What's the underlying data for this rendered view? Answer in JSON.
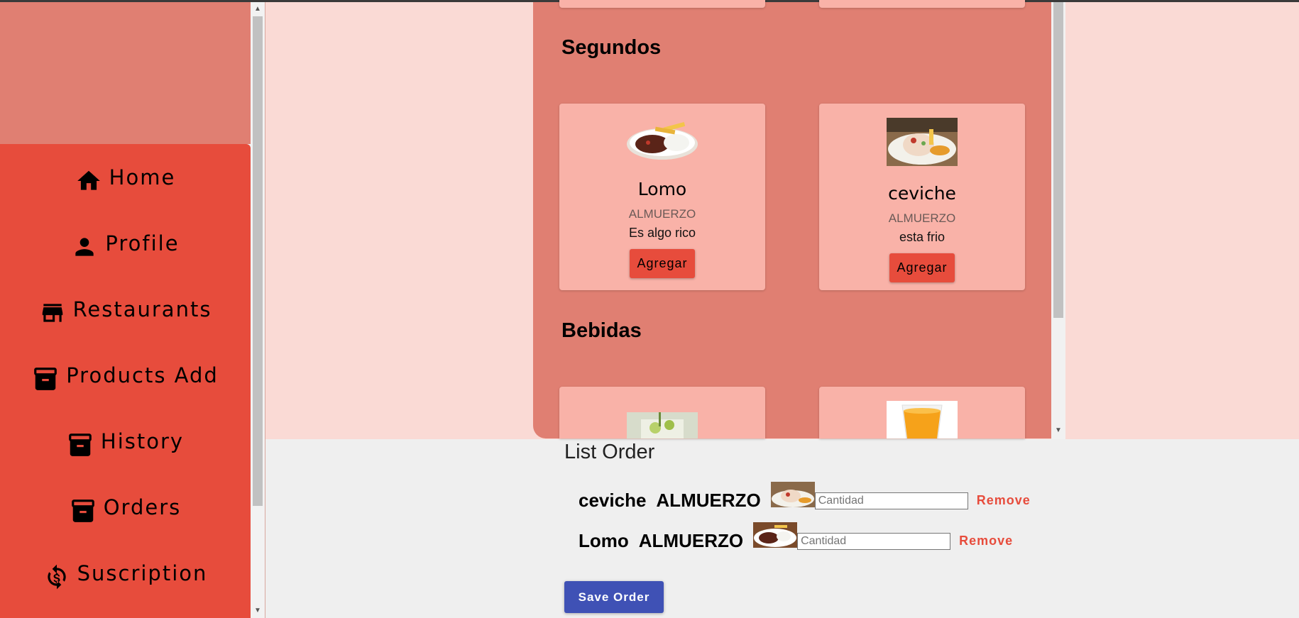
{
  "sidebar": {
    "items": [
      {
        "label": "Home",
        "icon": "home-icon"
      },
      {
        "label": "Profile",
        "icon": "person-icon"
      },
      {
        "label": "Restaurants",
        "icon": "store-icon"
      },
      {
        "label": "Products Add",
        "icon": "archive-icon"
      },
      {
        "label": "History",
        "icon": "archive-icon"
      },
      {
        "label": "Orders",
        "icon": "archive-icon"
      },
      {
        "label": "Suscription",
        "icon": "sync-dollar-icon"
      }
    ]
  },
  "menu": {
    "sections": [
      {
        "title": "Segundos",
        "products": [
          {
            "name": "Lomo",
            "category": "ALMUERZO",
            "description": "Es algo rico",
            "button": "Agregar"
          },
          {
            "name": "ceviche",
            "category": "ALMUERZO",
            "description": "esta frio",
            "button": "Agregar"
          }
        ]
      },
      {
        "title": "Bebidas",
        "products": []
      }
    ]
  },
  "order": {
    "title": "List Order",
    "items": [
      {
        "name": "ceviche",
        "category": "ALMUERZO",
        "quantity": "",
        "placeholder": "Cantidad",
        "remove": "Remove"
      },
      {
        "name": "Lomo",
        "category": "ALMUERZO",
        "quantity": "",
        "placeholder": "Cantidad",
        "remove": "Remove"
      }
    ],
    "save_label": "Save Order"
  },
  "colors": {
    "primary": "#e74c3c",
    "menu_background": "#e07f72",
    "card_background": "#f9b2a8",
    "pane_background": "#fadad5",
    "save_button": "#3f51b5"
  }
}
